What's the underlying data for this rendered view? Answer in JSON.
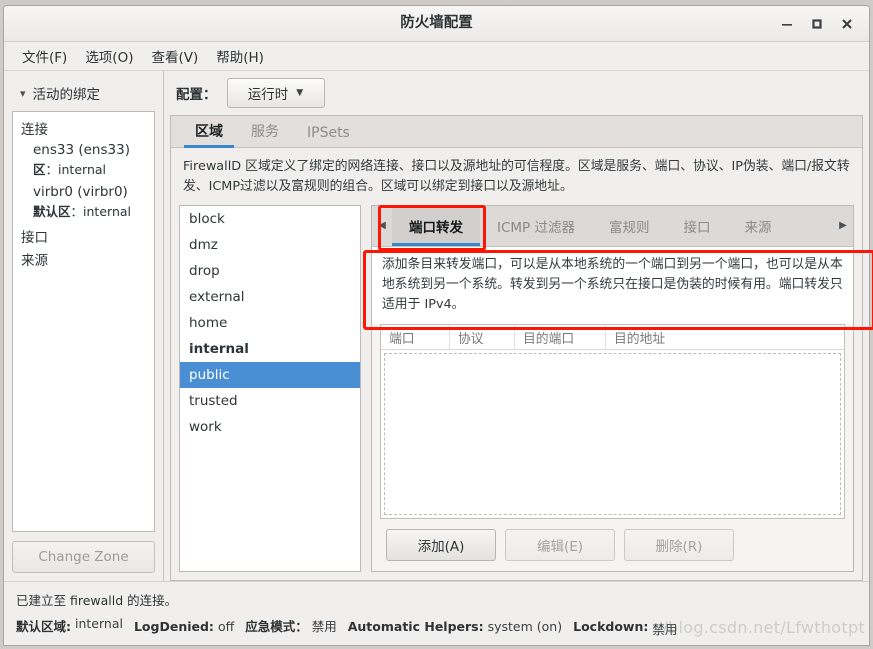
{
  "window": {
    "title": "防火墙配置",
    "controls": {
      "minimize": "minimize-icon",
      "maximize": "maximize-icon",
      "close": "close-icon"
    }
  },
  "menubar": {
    "items": [
      {
        "label": "文件(F)"
      },
      {
        "label": "选项(O)"
      },
      {
        "label": "查看(V)"
      },
      {
        "label": "帮助(H)"
      }
    ]
  },
  "sidebar": {
    "expander_label": "活动的绑定",
    "expander_icon": "chevron-down-icon",
    "groups": [
      {
        "title": "连接",
        "items": [
          {
            "name": "ens33 (ens33)",
            "sub_label": "区",
            "sub_value": "internal"
          },
          {
            "name": "virbr0 (virbr0)",
            "sub_label": "默认区",
            "sub_value": "internal"
          }
        ]
      },
      {
        "title": "接口",
        "items": []
      },
      {
        "title": "来源",
        "items": []
      }
    ],
    "change_zone_button": "Change Zone"
  },
  "config_bar": {
    "label": "配置：",
    "selected": "运行时",
    "dropdown_icon": "chevron-down-icon"
  },
  "top_tabs": [
    {
      "label": "区域",
      "active": true
    },
    {
      "label": "服务",
      "active": false
    },
    {
      "label": "IPSets",
      "active": false
    }
  ],
  "zone_description": "FirewallD 区域定义了绑定的网络连接、接口以及源地址的可信程度。区域是服务、端口、协议、IP伪装、端口/报文转发、ICMP过滤以及富规则的组合。区域可以绑定到接口以及源地址。",
  "zones": [
    {
      "name": "block",
      "bold": false,
      "selected": false
    },
    {
      "name": "dmz",
      "bold": false,
      "selected": false
    },
    {
      "name": "drop",
      "bold": false,
      "selected": false
    },
    {
      "name": "external",
      "bold": false,
      "selected": false
    },
    {
      "name": "home",
      "bold": false,
      "selected": false
    },
    {
      "name": "internal",
      "bold": true,
      "selected": false
    },
    {
      "name": "public",
      "bold": false,
      "selected": true
    },
    {
      "name": "trusted",
      "bold": false,
      "selected": false
    },
    {
      "name": "work",
      "bold": false,
      "selected": false
    }
  ],
  "inner_tabs": {
    "scroll_left_icon": "triangle-left-icon",
    "scroll_right_icon": "triangle-right-icon",
    "items": [
      {
        "label": "端口转发",
        "active": true
      },
      {
        "label": "ICMP 过滤器",
        "active": false
      },
      {
        "label": "富规则",
        "active": false
      },
      {
        "label": "接口",
        "active": false
      },
      {
        "label": "来源",
        "active": false
      }
    ]
  },
  "forward_description": "添加条目来转发端口，可以是从本地系统的一个端口到另一个端口，也可以是从本地系统到另一个系统。转发到另一个系统只在接口是伪装的时候有用。端口转发只适用于 IPv4。",
  "table": {
    "columns": [
      "端口",
      "协议",
      "目的端口",
      "目的地址"
    ],
    "rows": []
  },
  "action_buttons": [
    {
      "label": "添加(A)",
      "disabled": false
    },
    {
      "label": "编辑(E)",
      "disabled": true
    },
    {
      "label": "删除(R)",
      "disabled": true
    }
  ],
  "statusbar": {
    "connection_message": "已建立至 firewalld 的连接。",
    "fields": [
      {
        "key": "默认区域:",
        "value": "internal"
      },
      {
        "key": "LogDenied:",
        "value": "off"
      },
      {
        "key": "应急模式：",
        "value": "禁用"
      },
      {
        "key": "Automatic Helpers:",
        "value": "system (on)"
      },
      {
        "key": "Lockdown:",
        "value": "禁用"
      }
    ],
    "watermark": "://blog.csdn.net/Lfwthotpt"
  },
  "colors": {
    "accent": "#3b86ca",
    "selection": "#4a8fd4",
    "annotation": "#fb1605",
    "window_bg": "#f0efee"
  }
}
